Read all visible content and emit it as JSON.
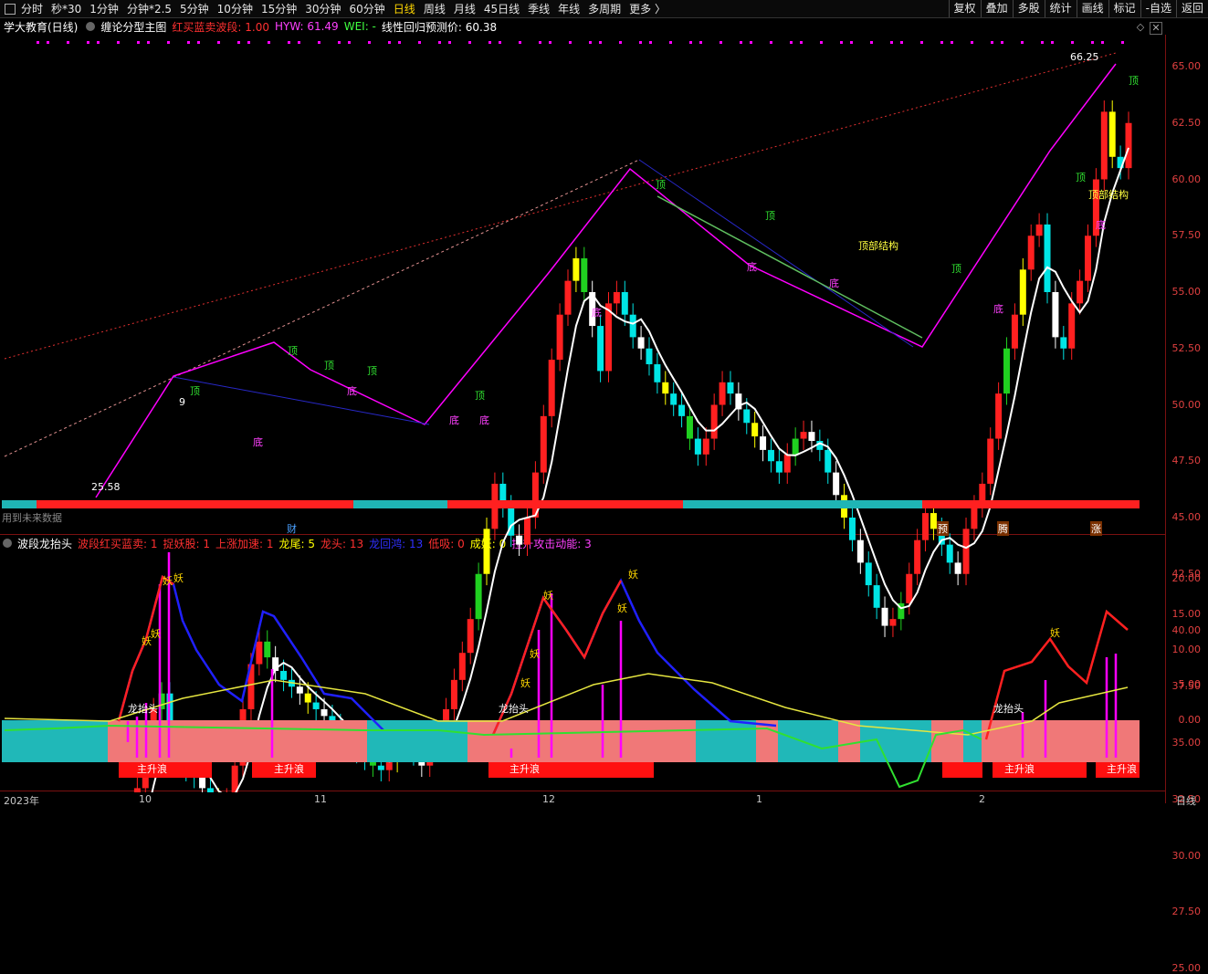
{
  "toolbar": {
    "periods": [
      "分时",
      "秒*30",
      "1分钟",
      "分钟*2.5",
      "5分钟",
      "10分钟",
      "15分钟",
      "30分钟",
      "60分钟",
      "日线",
      "周线",
      "月线",
      "45日线",
      "季线",
      "年线",
      "多周期",
      "更多 〉"
    ],
    "active_period": "日线",
    "right_buttons": [
      "复权",
      "叠加",
      "多股",
      "统计",
      "画线",
      "标记",
      "-自选",
      "返回"
    ]
  },
  "main_title": {
    "stock": "学大教育(日线)",
    "indicator": "缠论分型主图",
    "p1": "红买蓝卖波段: 1.00",
    "p2": "HYW: 61.49",
    "p3": "WEI: -",
    "p4": "线性回归预测价: 60.38"
  },
  "sub_title": {
    "name": "波段龙抬头",
    "i1": "波段红买蓝卖: 1",
    "i2": "捉妖股: 1",
    "i3": "上涨加速: 1",
    "i4": "龙尾: 5",
    "i5": "龙头: 13",
    "i6": "龙回鸿: 13",
    "i7": "低吸: 0",
    "i8": "成妖: 0",
    "i9": "拉升攻击动能: 3"
  },
  "price_axis": [
    "65.00",
    "62.50",
    "60.00",
    "57.50",
    "55.00",
    "52.50",
    "50.00",
    "47.50",
    "45.00",
    "42.50",
    "40.00",
    "37.50",
    "35.00",
    "32.50",
    "30.00",
    "27.50",
    "25.00"
  ],
  "sub_axis": [
    "20.00",
    "15.00",
    "10.00",
    "5.00",
    "0.00"
  ],
  "x_axis": [
    "2023年",
    "10",
    "11",
    "12",
    "1",
    "2"
  ],
  "axis_corner": "日线",
  "annotations": {
    "high": "66.25",
    "low": "25.58",
    "future_hint": "用到未来数据",
    "top_struct_1": "顶部结构",
    "top_struct_2": "顶部结构",
    "top": "顶",
    "bottom": "底",
    "cai": "财",
    "yu": "预",
    "teng": "腾",
    "zhang": "涨",
    "dragon": "龙抬头",
    "wave": "主升浪",
    "yao": "妖",
    "nine": "9"
  },
  "colors": {
    "up": "#ff2020",
    "down": "#00e5e5",
    "yellow": "#ffff00",
    "green": "#20d020",
    "magenta": "#ff00ff",
    "white": "#ffffff",
    "blue": "#2020ff"
  }
}
